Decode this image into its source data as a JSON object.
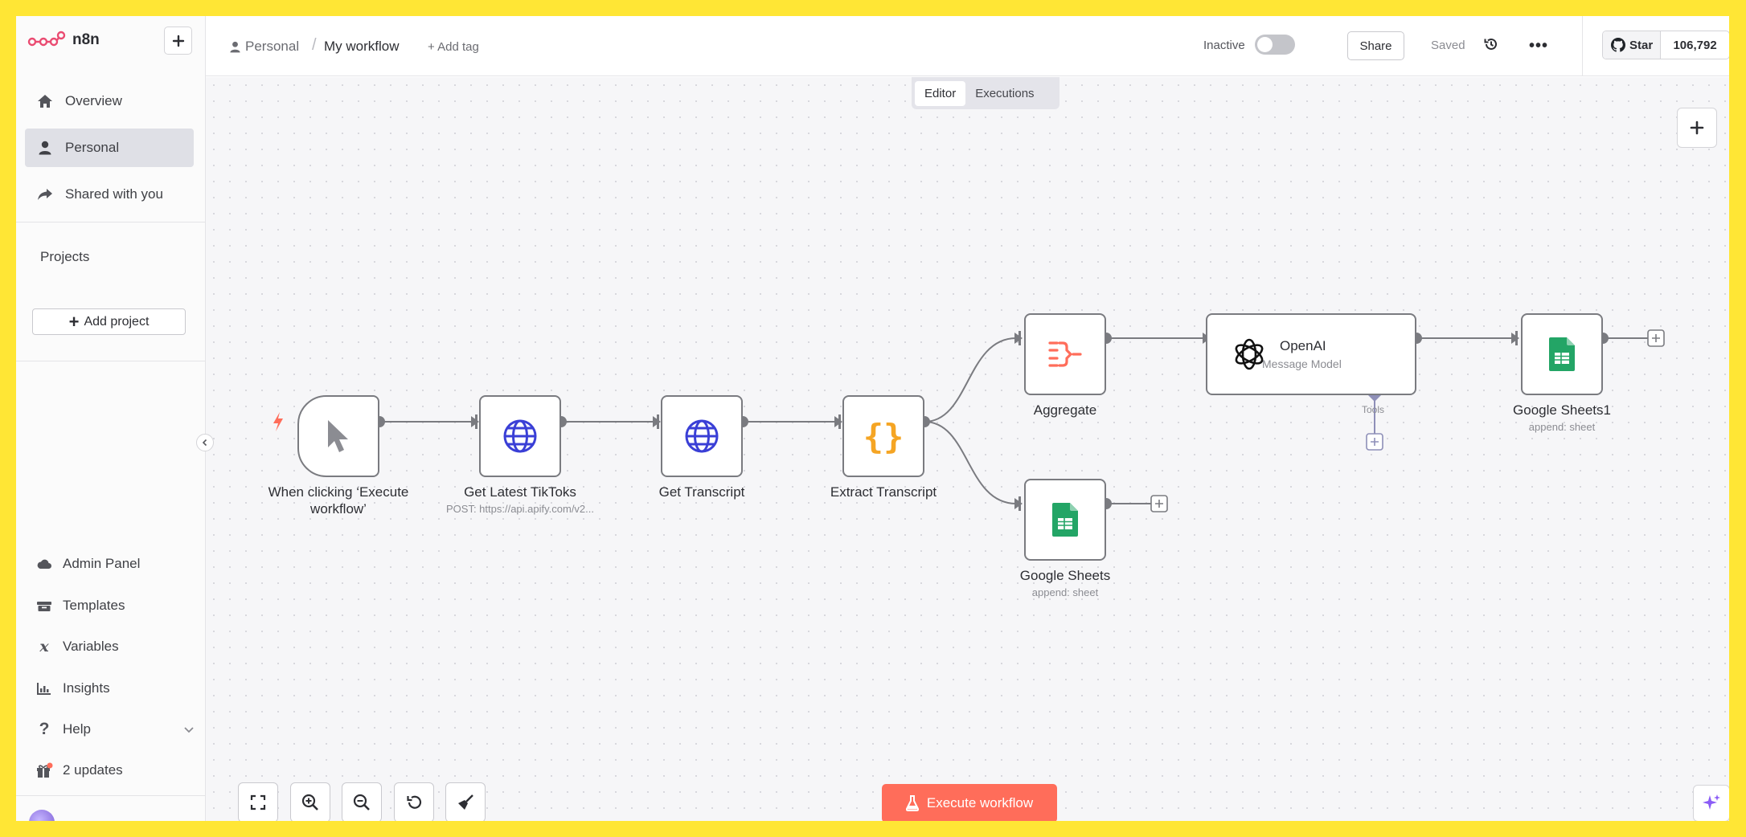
{
  "app": {
    "brand": "n8n",
    "accent_color": "#ff6d5a"
  },
  "sidebar": {
    "top_items": [
      {
        "label": "Overview",
        "icon": "home-icon"
      },
      {
        "label": "Personal",
        "icon": "user-icon",
        "active": true
      },
      {
        "label": "Shared with you",
        "icon": "share-icon"
      }
    ],
    "projects_label": "Projects",
    "add_project_label": "Add project",
    "bottom_items": [
      {
        "label": "Admin Panel",
        "icon": "cloud-icon"
      },
      {
        "label": "Templates",
        "icon": "box-icon"
      },
      {
        "label": "Variables",
        "icon": "variable-icon"
      },
      {
        "label": "Insights",
        "icon": "chart-icon"
      },
      {
        "label": "Help",
        "icon": "question-icon"
      },
      {
        "label": "2 updates",
        "icon": "gift-icon"
      }
    ]
  },
  "header": {
    "breadcrumb_project": "Personal",
    "breadcrumb_separator": "/",
    "workflow_name": "My workflow",
    "add_tag": "+ Add tag",
    "status_label": "Inactive",
    "share_label": "Share",
    "saved_label": "Saved",
    "more_label": "•••",
    "github_star_label": "Star",
    "github_star_count": "106,792"
  },
  "canvas": {
    "tabs": [
      {
        "label": "Editor",
        "active": true
      },
      {
        "label": "Executions",
        "active": false
      }
    ],
    "nodes": [
      {
        "id": "trigger",
        "label": "When clicking ‘Execute workflow’",
        "icon": "cursor-icon"
      },
      {
        "id": "tiktoks",
        "label": "Get Latest TikToks",
        "subtitle": "POST: https://api.apify.com/v2...",
        "icon": "globe-icon"
      },
      {
        "id": "transcript",
        "label": "Get Transcript",
        "icon": "globe-icon"
      },
      {
        "id": "extract",
        "label": "Extract Transcript",
        "icon": "code-braces-icon"
      },
      {
        "id": "aggregate",
        "label": "Aggregate",
        "icon": "aggregate-icon"
      },
      {
        "id": "openai",
        "label": "OpenAI",
        "subtitle": "Message Model",
        "icon": "openai-icon",
        "tools_label": "Tools"
      },
      {
        "id": "sheets1",
        "label": "Google Sheets1",
        "subtitle": "append: sheet",
        "icon": "google-sheets-icon"
      },
      {
        "id": "sheets",
        "label": "Google Sheets",
        "subtitle": "append: sheet",
        "icon": "google-sheets-icon"
      }
    ],
    "execute_button_label": "Execute workflow"
  }
}
